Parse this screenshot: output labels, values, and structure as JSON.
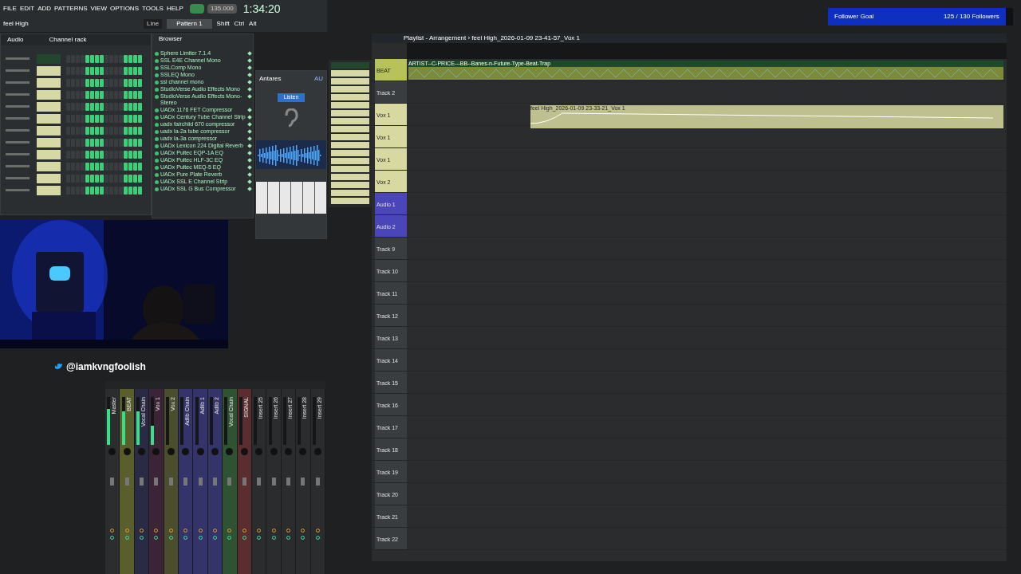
{
  "toolbar": {
    "menu": [
      "FILE",
      "EDIT",
      "ADD",
      "PATTERNS",
      "VIEW",
      "OPTIONS",
      "TOOLS",
      "HELP"
    ],
    "tempo": "135.000",
    "time": "1:34:20",
    "snap": "Line",
    "pattern": "Pattern 1",
    "keys": [
      "Shift",
      "Ctrl",
      "Alt"
    ],
    "song": "feel High",
    "playing": false
  },
  "channel_rack": {
    "title": "Channel rack",
    "filter": "Audio"
  },
  "browser": {
    "title": "Browser",
    "plugins": [
      "Sphere Limiter 7.1.4",
      "SSL E4E Channel Mono",
      "SSLComp Mono",
      "SSLEQ Mono",
      "ssl channel mono",
      "StudioVerse Audio Effects Mono",
      "StudioVerse Audio Effects Mono-Stereo",
      "UADx 1176 FET Compressor",
      "UADx Century Tube Channel Strip",
      "uadx fairchild 670 compressor",
      "uadx la-2a tube compressor",
      "uadx la-3a compressor",
      "UADx Lexicon 224 Digital Reverb",
      "UADx Pultec EQP-1A EQ",
      "UADx Pultec HLF-3C EQ",
      "UADx Pultec MEQ-5 EQ",
      "UADx Pure Plate Reverb",
      "UADx SSL E Channel Strip",
      "UADx SSL G Bus Compressor"
    ]
  },
  "plugin": {
    "brand": "Antares",
    "badge": "AU",
    "button": "Listen"
  },
  "playlist": {
    "title": "Playlist - Arrangement › feel High_2026-01-09 23-41-57_Vox 1",
    "tracks": [
      {
        "name": "BEAT",
        "color": "#b7c35a",
        "clip": "ARTIST--C-PRICE---BB--Banes-n-Future-Type-Beat-Trap",
        "kind": "beat"
      },
      {
        "name": "Track 2",
        "color": "#3a3d40"
      },
      {
        "name": "Vox 1",
        "color": "#d8d9a0",
        "clip": "feel High_2026-01-09 23-33-21_Vox 1",
        "kind": "vox"
      },
      {
        "name": "Vox 1",
        "color": "#d8d9a0"
      },
      {
        "name": "Vox 1",
        "color": "#d8d9a0"
      },
      {
        "name": "Vox 2",
        "color": "#d8d9a0"
      },
      {
        "name": "Audio 1",
        "color": "#4a45b8"
      },
      {
        "name": "Audio 2",
        "color": "#4a45b8"
      },
      {
        "name": "Track 9",
        "color": "#3a3d40"
      },
      {
        "name": "Track 10",
        "color": "#3a3d40"
      },
      {
        "name": "Track 11",
        "color": "#3a3d40"
      },
      {
        "name": "Track 12",
        "color": "#3a3d40"
      },
      {
        "name": "Track 13",
        "color": "#3a3d40"
      },
      {
        "name": "Track 14",
        "color": "#3a3d40"
      },
      {
        "name": "Track 15",
        "color": "#3a3d40"
      },
      {
        "name": "Track 16",
        "color": "#3a3d40"
      },
      {
        "name": "Track 17",
        "color": "#3a3d40"
      },
      {
        "name": "Track 18",
        "color": "#3a3d40"
      },
      {
        "name": "Track 19",
        "color": "#3a3d40"
      },
      {
        "name": "Track 20",
        "color": "#3a3d40"
      },
      {
        "name": "Track 21",
        "color": "#3a3d40"
      },
      {
        "name": "Track 22",
        "color": "#3a3d40"
      }
    ]
  },
  "follower_goal": {
    "label": "Follower Goal",
    "count": "125 / 130 Followers",
    "level": 0.96
  },
  "webcam": {
    "kind": "picture",
    "handle": "@iamkvngfoolish"
  },
  "mixer": {
    "strips": [
      {
        "name": "Master",
        "color": "#2b2d2e",
        "level": 0.75
      },
      {
        "name": "BEAT",
        "color": "#5a5d2c",
        "level": 0.7
      },
      {
        "name": "Vocal Chain",
        "color": "#2b2a44",
        "level": 0.7
      },
      {
        "name": "Vox 1",
        "color": "#3a2436",
        "level": 0.4
      },
      {
        "name": "Vox 2",
        "color": "#4b4e2c"
      },
      {
        "name": "Adlib Chain",
        "color": "#34336a"
      },
      {
        "name": "Adlib 1",
        "color": "#34336a"
      },
      {
        "name": "Adlib 2",
        "color": "#34336a"
      },
      {
        "name": "Vocal Chain",
        "color": "#2f5232"
      },
      {
        "name": "SIGNAL",
        "color": "#5a2e31"
      },
      {
        "name": "Insert 25",
        "color": "#2a2c2e"
      },
      {
        "name": "Insert 26",
        "color": "#2a2c2e"
      },
      {
        "name": "Insert 27",
        "color": "#2a2c2e"
      },
      {
        "name": "Insert 28",
        "color": "#2a2c2e"
      },
      {
        "name": "Insert 29",
        "color": "#2a2c2e"
      }
    ]
  }
}
